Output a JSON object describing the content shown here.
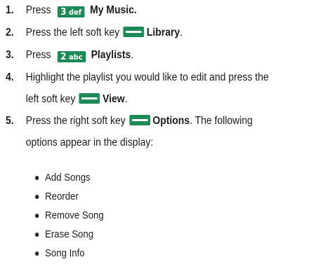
{
  "steps": [
    {
      "number": "1.",
      "before": "Press",
      "key": {
        "digit": "3",
        "letters": "def"
      },
      "bold": "My Music.",
      "after": ""
    },
    {
      "number": "2.",
      "before": "Press the left soft key",
      "bold": "Library",
      "after": "."
    },
    {
      "number": "3.",
      "before": "Press",
      "key": {
        "digit": "2",
        "letters": "abc"
      },
      "bold": "Playlists",
      "after": "."
    },
    {
      "number": "4.",
      "line1": "Highlight the playlist you would like to edit and press the",
      "before": "left soft key",
      "bold": "View",
      "after": "."
    },
    {
      "number": "5.",
      "before": "Press the right soft key",
      "bold": "Options",
      "after": ". The following",
      "line2": "options appear in the display:"
    }
  ],
  "options": [
    "Add Songs",
    "Reorder",
    "Remove Song",
    "Erase Song",
    "Song Info"
  ],
  "colors": {
    "key_bg": "#1d8a57",
    "key_fg": "#ffffff",
    "text": "#1a1a1a"
  }
}
